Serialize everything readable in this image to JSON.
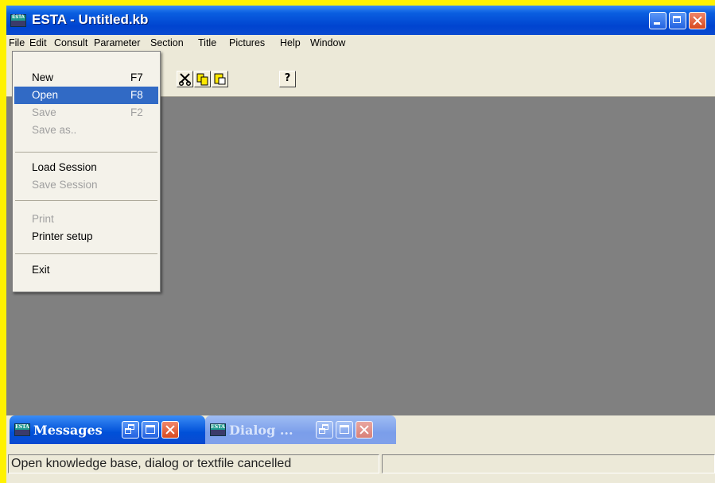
{
  "window": {
    "title": "ESTA - Untitled.kb",
    "icon": "esta-app-icon"
  },
  "menubar": {
    "items": [
      "File",
      "Edit",
      "Consult",
      "Parameter",
      "Section",
      "Title",
      "Pictures",
      "Help",
      "Window"
    ]
  },
  "toolbar": {
    "buttons": [
      {
        "icon": "cut-icon"
      },
      {
        "icon": "copy-icon"
      },
      {
        "icon": "paste-icon"
      },
      {
        "icon": "help-icon",
        "label": "?"
      }
    ]
  },
  "file_menu": {
    "items": [
      {
        "label": "New",
        "shortcut": "F7",
        "enabled": true
      },
      {
        "label": "Open",
        "shortcut": "F8",
        "enabled": true,
        "selected": true
      },
      {
        "label": "Save",
        "shortcut": "F2",
        "enabled": false
      },
      {
        "label": "Save as..",
        "shortcut": "",
        "enabled": false
      },
      {
        "label": "Load Session",
        "shortcut": "",
        "enabled": true
      },
      {
        "label": "Save Session",
        "shortcut": "",
        "enabled": false
      },
      {
        "label": "Print",
        "shortcut": "",
        "enabled": false
      },
      {
        "label": "Printer setup",
        "shortcut": "",
        "enabled": true
      },
      {
        "label": "Exit",
        "shortcut": "",
        "enabled": true
      }
    ]
  },
  "minimized": [
    {
      "title": "Messages",
      "active": true
    },
    {
      "title": "Dialog ...",
      "active": false
    }
  ],
  "statusbar": {
    "message": "Open knowledge base, dialog or textfile cancelled",
    "secondary": ""
  },
  "colors": {
    "titlebar": "#0a5fe0",
    "selection": "#316ac5",
    "client_background": "#808080",
    "desktop_border": "#fff200"
  }
}
